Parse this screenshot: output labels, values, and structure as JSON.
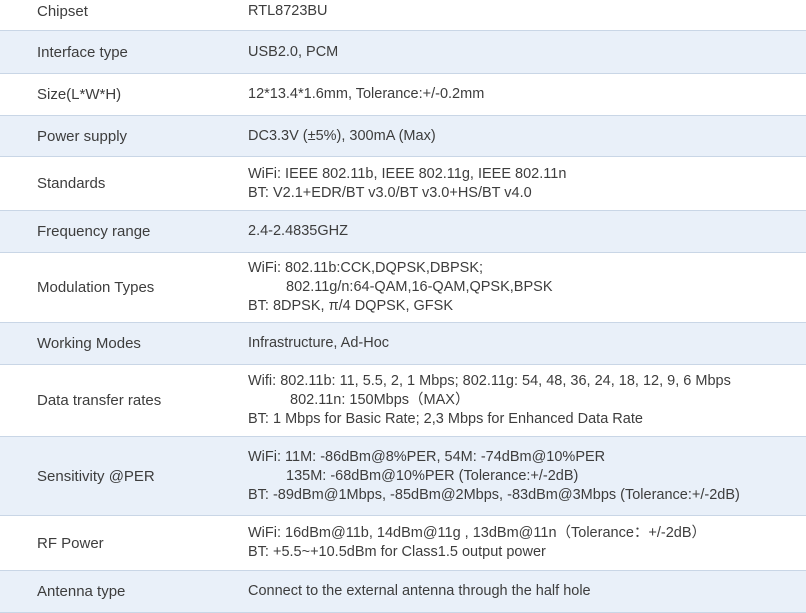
{
  "rows": [
    {
      "label": "Chipset",
      "lines": [
        "RTL8723BU"
      ]
    },
    {
      "label": "Interface type",
      "lines": [
        "USB2.0, PCM"
      ]
    },
    {
      "label": "Size(L*W*H)",
      "lines": [
        "12*13.4*1.6mm, Tolerance:+/-0.2mm"
      ]
    },
    {
      "label": "Power supply",
      "lines": [
        "DC3.3V (±5%), 300mA (Max)"
      ]
    },
    {
      "label": "Standards",
      "lines": [
        "WiFi:  IEEE 802.11b, IEEE 802.11g, IEEE 802.11n",
        "BT:     V2.1+EDR/BT v3.0/BT v3.0+HS/BT v4.0"
      ]
    },
    {
      "label": "Frequency range",
      "lines": [
        "2.4-2.4835GHZ"
      ]
    },
    {
      "label": "Modulation Types",
      "lines": [
        "WiFi: 802.11b:CCK,DQPSK,DBPSK;",
        "802.11g/n:64-QAM,16-QAM,QPSK,BPSK",
        "BT:   8DPSK, π/4 DQPSK, GFSK"
      ]
    },
    {
      "label": "Working Modes",
      "lines": [
        "Infrastructure,  Ad-Hoc"
      ]
    },
    {
      "label": "Data transfer rates",
      "lines": [
        "Wifi:  802.11b: 11, 5.5, 2, 1 Mbps; 802.11g: 54, 48, 36, 24, 18, 12, 9, 6 Mbps",
        "802.11n: 150Mbps（MAX）",
        "BT:  1 Mbps for Basic Rate; 2,3 Mbps for Enhanced Data Rate"
      ]
    },
    {
      "label": "Sensitivity @PER",
      "lines": [
        "WiFi: 11M: -86dBm@8%PER, 54M: -74dBm@10%PER",
        "135M: -68dBm@10%PER (Tolerance:+/-2dB)",
        "BT: -89dBm@1Mbps, -85dBm@2Mbps, -83dBm@3Mbps (Tolerance:+/-2dB)"
      ]
    },
    {
      "label": "RF Power",
      "lines": [
        "WiFi: 16dBm@11b,  14dBm@11g , 13dBm@11n（Tolerance：+/-2dB）",
        "BT:     +5.5~+10.5dBm for Class1.5 output power"
      ]
    },
    {
      "label": "Antenna type",
      "lines": [
        "Connect to the external antenna through the half hole"
      ]
    }
  ]
}
